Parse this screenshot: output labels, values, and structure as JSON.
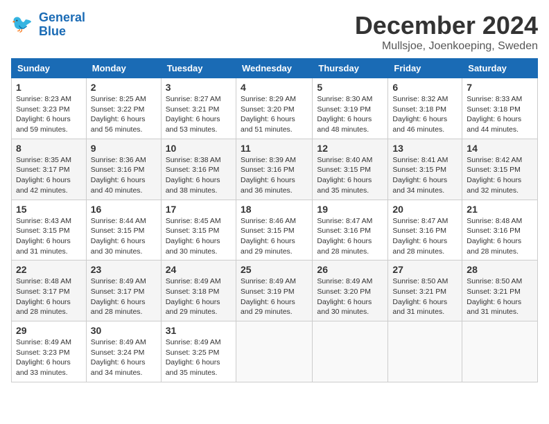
{
  "header": {
    "logo_line1": "General",
    "logo_line2": "Blue",
    "month_title": "December 2024",
    "location": "Mullsjoe, Joenkoeping, Sweden"
  },
  "days_of_week": [
    "Sunday",
    "Monday",
    "Tuesday",
    "Wednesday",
    "Thursday",
    "Friday",
    "Saturday"
  ],
  "weeks": [
    [
      {
        "day": "1",
        "sunrise": "8:23 AM",
        "sunset": "3:23 PM",
        "daylight_hours": "6",
        "daylight_minutes": "59"
      },
      {
        "day": "2",
        "sunrise": "8:25 AM",
        "sunset": "3:22 PM",
        "daylight_hours": "6",
        "daylight_minutes": "56"
      },
      {
        "day": "3",
        "sunrise": "8:27 AM",
        "sunset": "3:21 PM",
        "daylight_hours": "6",
        "daylight_minutes": "53"
      },
      {
        "day": "4",
        "sunrise": "8:29 AM",
        "sunset": "3:20 PM",
        "daylight_hours": "6",
        "daylight_minutes": "51"
      },
      {
        "day": "5",
        "sunrise": "8:30 AM",
        "sunset": "3:19 PM",
        "daylight_hours": "6",
        "daylight_minutes": "48"
      },
      {
        "day": "6",
        "sunrise": "8:32 AM",
        "sunset": "3:18 PM",
        "daylight_hours": "6",
        "daylight_minutes": "46"
      },
      {
        "day": "7",
        "sunrise": "8:33 AM",
        "sunset": "3:18 PM",
        "daylight_hours": "6",
        "daylight_minutes": "44"
      }
    ],
    [
      {
        "day": "8",
        "sunrise": "8:35 AM",
        "sunset": "3:17 PM",
        "daylight_hours": "6",
        "daylight_minutes": "42"
      },
      {
        "day": "9",
        "sunrise": "8:36 AM",
        "sunset": "3:16 PM",
        "daylight_hours": "6",
        "daylight_minutes": "40"
      },
      {
        "day": "10",
        "sunrise": "8:38 AM",
        "sunset": "3:16 PM",
        "daylight_hours": "6",
        "daylight_minutes": "38"
      },
      {
        "day": "11",
        "sunrise": "8:39 AM",
        "sunset": "3:16 PM",
        "daylight_hours": "6",
        "daylight_minutes": "36"
      },
      {
        "day": "12",
        "sunrise": "8:40 AM",
        "sunset": "3:15 PM",
        "daylight_hours": "6",
        "daylight_minutes": "35"
      },
      {
        "day": "13",
        "sunrise": "8:41 AM",
        "sunset": "3:15 PM",
        "daylight_hours": "6",
        "daylight_minutes": "34"
      },
      {
        "day": "14",
        "sunrise": "8:42 AM",
        "sunset": "3:15 PM",
        "daylight_hours": "6",
        "daylight_minutes": "32"
      }
    ],
    [
      {
        "day": "15",
        "sunrise": "8:43 AM",
        "sunset": "3:15 PM",
        "daylight_hours": "6",
        "daylight_minutes": "31"
      },
      {
        "day": "16",
        "sunrise": "8:44 AM",
        "sunset": "3:15 PM",
        "daylight_hours": "6",
        "daylight_minutes": "30"
      },
      {
        "day": "17",
        "sunrise": "8:45 AM",
        "sunset": "3:15 PM",
        "daylight_hours": "6",
        "daylight_minutes": "30"
      },
      {
        "day": "18",
        "sunrise": "8:46 AM",
        "sunset": "3:15 PM",
        "daylight_hours": "6",
        "daylight_minutes": "29"
      },
      {
        "day": "19",
        "sunrise": "8:47 AM",
        "sunset": "3:16 PM",
        "daylight_hours": "6",
        "daylight_minutes": "28"
      },
      {
        "day": "20",
        "sunrise": "8:47 AM",
        "sunset": "3:16 PM",
        "daylight_hours": "6",
        "daylight_minutes": "28"
      },
      {
        "day": "21",
        "sunrise": "8:48 AM",
        "sunset": "3:16 PM",
        "daylight_hours": "6",
        "daylight_minutes": "28"
      }
    ],
    [
      {
        "day": "22",
        "sunrise": "8:48 AM",
        "sunset": "3:17 PM",
        "daylight_hours": "6",
        "daylight_minutes": "28"
      },
      {
        "day": "23",
        "sunrise": "8:49 AM",
        "sunset": "3:17 PM",
        "daylight_hours": "6",
        "daylight_minutes": "28"
      },
      {
        "day": "24",
        "sunrise": "8:49 AM",
        "sunset": "3:18 PM",
        "daylight_hours": "6",
        "daylight_minutes": "29"
      },
      {
        "day": "25",
        "sunrise": "8:49 AM",
        "sunset": "3:19 PM",
        "daylight_hours": "6",
        "daylight_minutes": "29"
      },
      {
        "day": "26",
        "sunrise": "8:49 AM",
        "sunset": "3:20 PM",
        "daylight_hours": "6",
        "daylight_minutes": "30"
      },
      {
        "day": "27",
        "sunrise": "8:50 AM",
        "sunset": "3:21 PM",
        "daylight_hours": "6",
        "daylight_minutes": "31"
      },
      {
        "day": "28",
        "sunrise": "8:50 AM",
        "sunset": "3:21 PM",
        "daylight_hours": "6",
        "daylight_minutes": "31"
      }
    ],
    [
      {
        "day": "29",
        "sunrise": "8:49 AM",
        "sunset": "3:23 PM",
        "daylight_hours": "6",
        "daylight_minutes": "33"
      },
      {
        "day": "30",
        "sunrise": "8:49 AM",
        "sunset": "3:24 PM",
        "daylight_hours": "6",
        "daylight_minutes": "34"
      },
      {
        "day": "31",
        "sunrise": "8:49 AM",
        "sunset": "3:25 PM",
        "daylight_hours": "6",
        "daylight_minutes": "35"
      },
      null,
      null,
      null,
      null
    ]
  ],
  "labels": {
    "sunrise": "Sunrise:",
    "sunset": "Sunset:",
    "daylight": "Daylight: ",
    "hours_suffix": " hours",
    "and": "and ",
    "minutes_suffix": " minutes."
  }
}
